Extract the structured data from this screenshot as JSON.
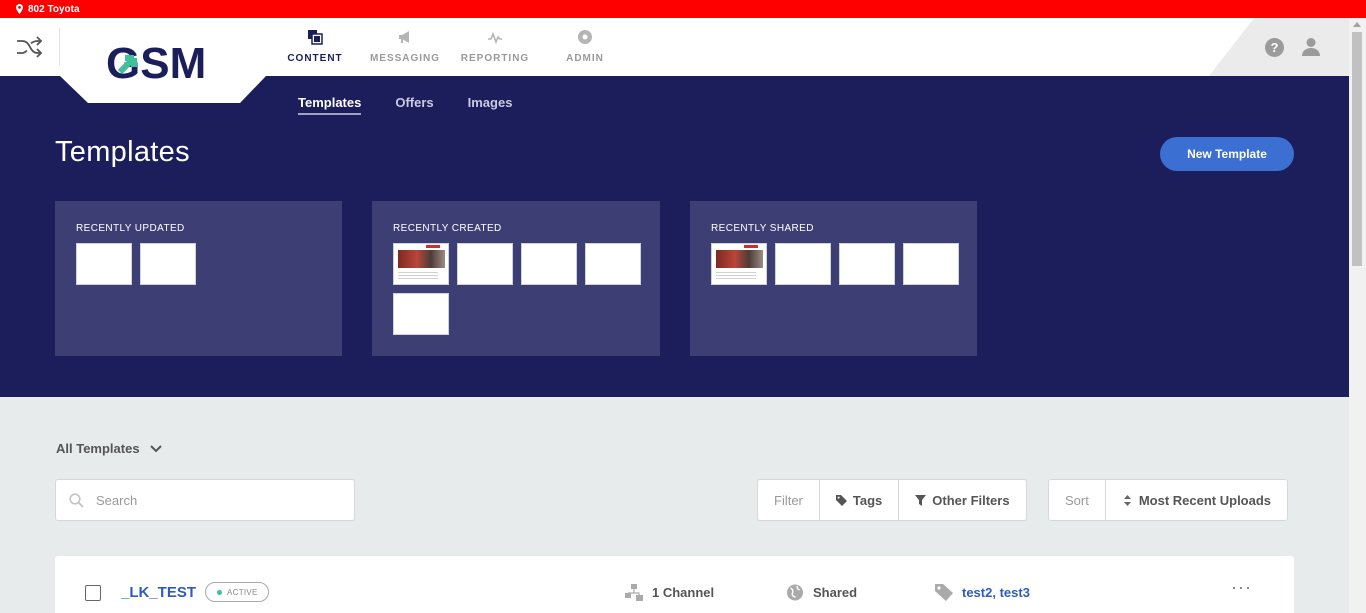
{
  "topbar": {
    "location": "802 Toyota"
  },
  "header": {
    "logo_text": "GSM",
    "nav": [
      {
        "label": "CONTENT",
        "icon": "layers-icon",
        "active": true
      },
      {
        "label": "MESSAGING",
        "icon": "megaphone-icon",
        "active": false
      },
      {
        "label": "REPORTING",
        "icon": "pulse-icon",
        "active": false
      },
      {
        "label": "ADMIN",
        "icon": "gear-icon",
        "active": false
      }
    ],
    "help_label": "?"
  },
  "subnav": {
    "items": [
      "Templates",
      "Offers",
      "Images"
    ],
    "active": "Templates"
  },
  "page": {
    "title": "Templates",
    "new_button": "New Template"
  },
  "recent": [
    {
      "title": "RECENTLY UPDATED",
      "thumbnails": [
        "blank",
        "blank"
      ]
    },
    {
      "title": "RECENTLY CREATED",
      "thumbnails": [
        "image",
        "blank",
        "blank",
        "blank",
        "blank"
      ]
    },
    {
      "title": "RECENTLY SHARED",
      "thumbnails": [
        "image",
        "blank",
        "blank",
        "blank"
      ]
    }
  ],
  "list": {
    "scope_label": "All Templates",
    "search_placeholder": "Search",
    "filter": {
      "label": "Filter",
      "tags": "Tags",
      "other": "Other Filters"
    },
    "sort": {
      "label": "Sort",
      "value": "Most Recent Uploads"
    }
  },
  "rows": [
    {
      "name": "_LK_TEST",
      "status": "ACTIVE",
      "channels": "1 Channel",
      "sharing": "Shared",
      "tags": "test2, test3",
      "more": "···"
    }
  ],
  "colors": {
    "hero": "#1c1e5c",
    "card": "#3d3f74",
    "accent": "#3b6fd1",
    "alert": "#fe0000",
    "active_dot": "#3fbf9a"
  }
}
